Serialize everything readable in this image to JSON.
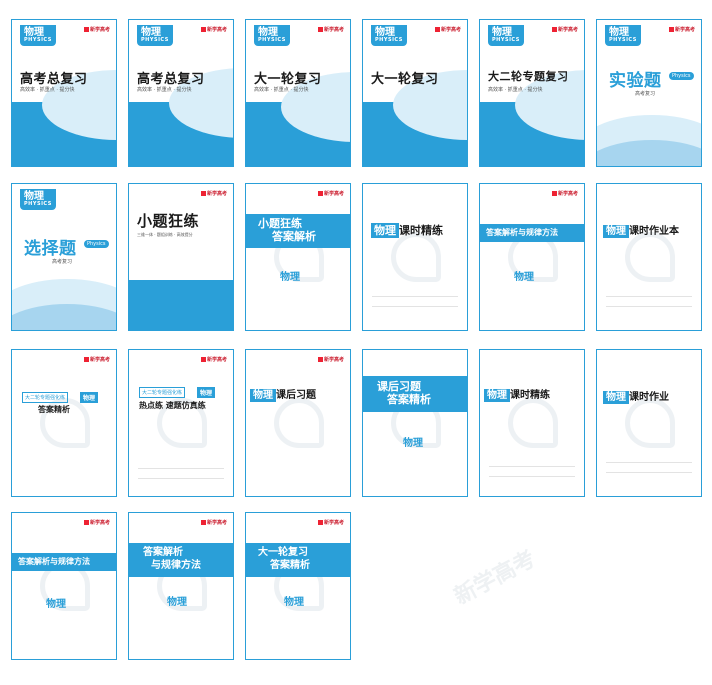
{
  "watermark": "新学高考",
  "brand": "新学高考",
  "common": {
    "physics_cn": "物理",
    "physics_en": "PHYSICS",
    "subtitle_tags": "高效率 · 抓重点 · 提分快",
    "exam": "高考复习",
    "accent": "#2a9fd8"
  },
  "covers": [
    {
      "title": "高考总复习"
    },
    {
      "title": "高考总复习"
    },
    {
      "title": "大一轮复习"
    },
    {
      "title": "大一轮复习"
    },
    {
      "title": "大二轮专题复习"
    },
    {
      "title": "实验题",
      "pill": "Physics",
      "sub": "高考复习"
    },
    {
      "title": "选择题",
      "pill": "Physics",
      "sub": "高考复习"
    },
    {
      "title": "小题狂练",
      "sub": "三维一体 · 题组训练 · 高效提分"
    },
    {
      "title_line1": "小题狂练",
      "title_line2": "答案解析",
      "physics": "物理"
    },
    {
      "boxed": "物理",
      "title": "课时精练"
    },
    {
      "title": "答案解析与规律方法",
      "physics": "物理"
    },
    {
      "boxed": "物理",
      "title": "课时作业本"
    },
    {
      "kicker": "大二轮专题强化练",
      "tag": "物理",
      "title": "答案精析"
    },
    {
      "kicker": "大二轮专题强化练",
      "tag": "物理",
      "title": "热点练 速题仿真练"
    },
    {
      "boxed": "物理",
      "title": "课后习题"
    },
    {
      "title_line1": "课后习题",
      "title_line2": "答案精析",
      "physics": "物理"
    },
    {
      "boxed": "物理",
      "title": "课时精练"
    },
    {
      "boxed": "物理",
      "title": "课时作业"
    },
    {
      "title": "答案解析与规律方法",
      "physics": "物理"
    },
    {
      "title_line1": "答案解析",
      "title_line2": "与规律方法",
      "physics": "物理"
    },
    {
      "title_line1": "大一轮复习",
      "title_line2": "答案精析",
      "physics": "物理"
    }
  ]
}
